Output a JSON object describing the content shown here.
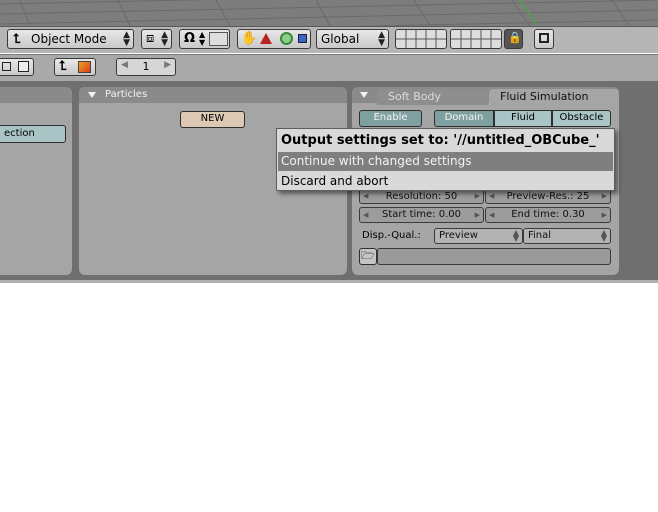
{
  "header": {
    "mode_label": "Object Mode",
    "orientation_label": "Global"
  },
  "buttons_header": {
    "frame_value": "1"
  },
  "left_panel": {
    "button_label": "ection"
  },
  "particles_panel": {
    "title": "Particles",
    "new_label": "NEW"
  },
  "physics_panel": {
    "tabs": [
      "Soft Body",
      "Fluid Simulation"
    ],
    "enable_label": "Enable",
    "type_buttons": [
      "Domain",
      "Fluid",
      "Obstacle"
    ],
    "resolution": "Resolution: 50",
    "preview_res": "Preview-Res.: 25",
    "start_time": "Start time: 0.00",
    "end_time": "End time: 0.30",
    "disp_qual_label": "Disp.-Qual.:",
    "viewport_display": "Preview",
    "render_display": "Final",
    "path_value": ""
  },
  "popup": {
    "title": "Output settings set to: '//untitled_OBCube_'",
    "items": [
      "Continue with changed settings",
      "Discard and abort"
    ]
  }
}
